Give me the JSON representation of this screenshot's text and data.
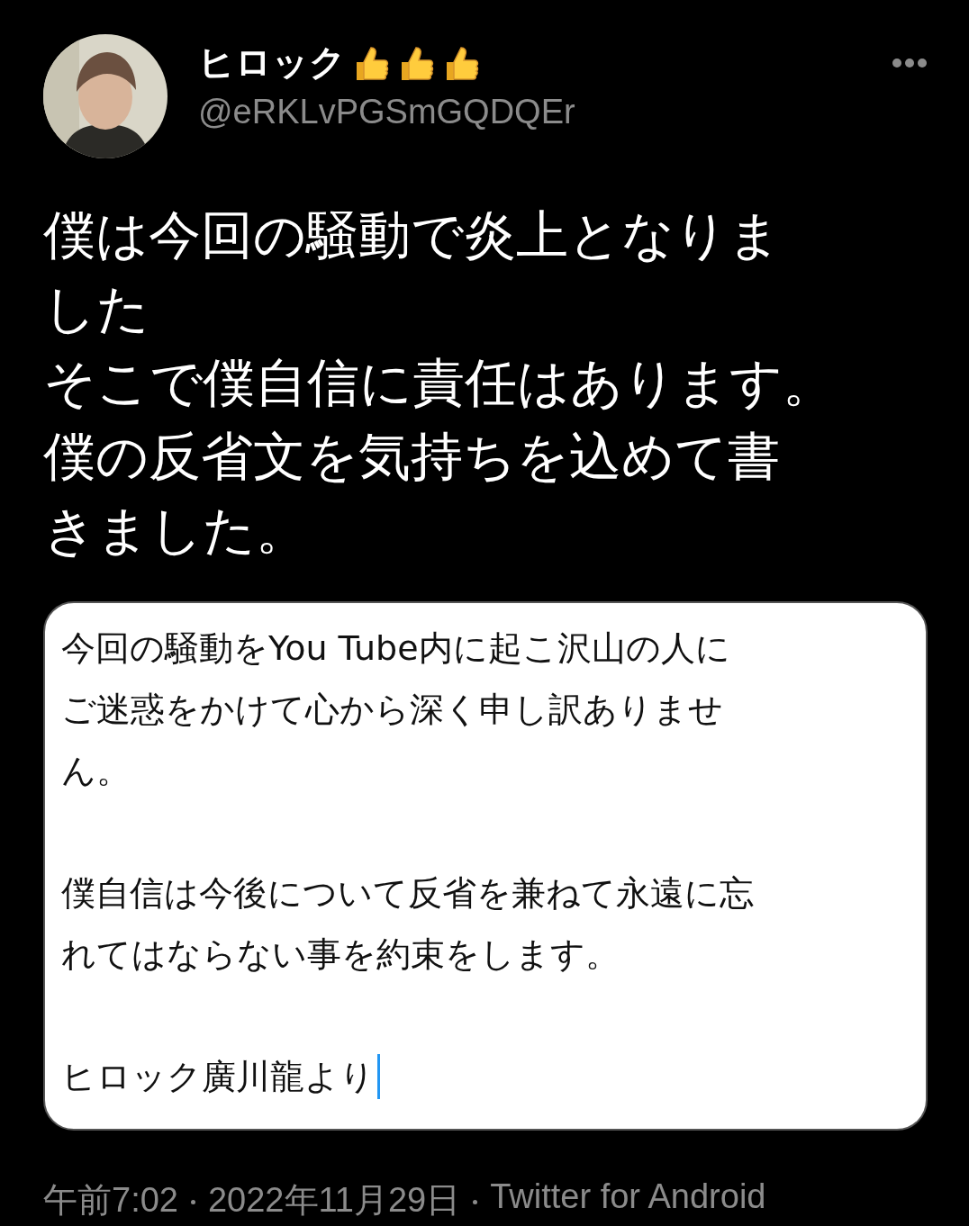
{
  "author": {
    "display_name": "ヒロック",
    "handle": "@eRKLvPGSmGQDQEr"
  },
  "tweet_lines": [
    "僕は今回の騒動で炎上となりま",
    "した",
    "そこで僕自信に責任はあります。",
    "僕の反省文を気持ちを込めて書",
    "きました。"
  ],
  "attached_note": {
    "paragraphs": [
      {
        "lines": [
          "今回の騒動をYou Tube内に起こ沢山の人に",
          "ご迷惑をかけて心から深く申し訳ありませ",
          "ん。"
        ]
      },
      {
        "lines": [
          "僕自信は今後について反省を兼ねて永遠に忘",
          "れてはならない事を約束をします。"
        ]
      },
      {
        "lines": [
          "ヒロック廣川龍より"
        ]
      }
    ]
  },
  "footer": {
    "time": "午前7:02",
    "date": "2022年11月29日",
    "source": "Twitter for Android"
  }
}
